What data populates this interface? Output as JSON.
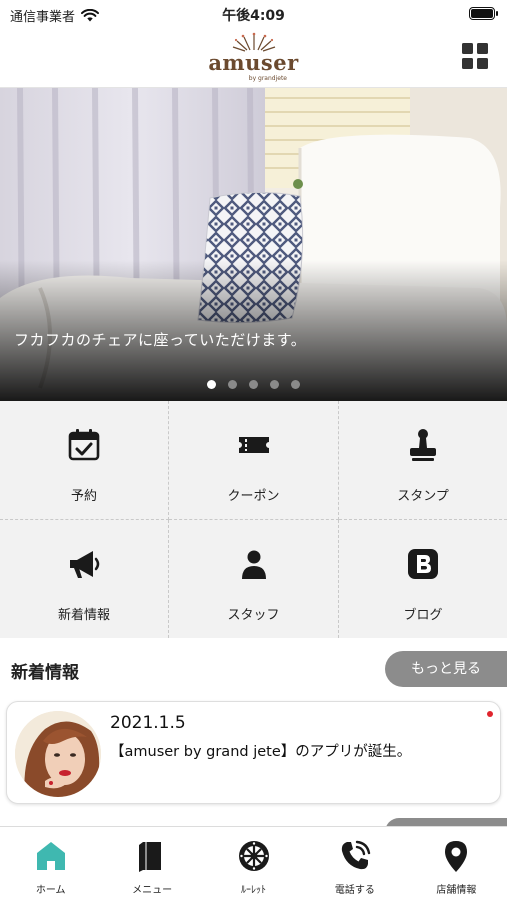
{
  "status_bar": {
    "carrier": "通信事業者",
    "time": "午後4:09"
  },
  "header": {
    "logo_text": "amuser",
    "logo_sub": "by grandjete"
  },
  "hero": {
    "caption": "フカフカのチェアに座っていただけます。",
    "slide_count": 5,
    "active_slide": 1
  },
  "features": [
    {
      "label": "予約",
      "icon": "calendar-icon"
    },
    {
      "label": "クーポン",
      "icon": "ticket-icon"
    },
    {
      "label": "スタンプ",
      "icon": "stamp-icon"
    },
    {
      "label": "新着情報",
      "icon": "megaphone-icon"
    },
    {
      "label": "スタッフ",
      "icon": "person-icon"
    },
    {
      "label": "ブログ",
      "icon": "blog-icon"
    }
  ],
  "news": {
    "title": "新着情報",
    "more_label": "もっと見る",
    "items": [
      {
        "date": "2021.1.5",
        "text": "【amuser by grand jete】のアプリが誕生。",
        "unread": true
      }
    ]
  },
  "tabs": [
    {
      "label": "ホーム",
      "icon": "home-icon",
      "active": true
    },
    {
      "label": "メニュー",
      "icon": "book-icon"
    },
    {
      "label": "ﾙｰﾚｯﾄ",
      "icon": "roulette-icon"
    },
    {
      "label": "電話する",
      "icon": "phone-icon"
    },
    {
      "label": "店舗情報",
      "icon": "map-pin-icon"
    }
  ],
  "colors": {
    "accent_active_tab": "#3fb8b0",
    "logo_brown": "#6b4a2f",
    "more_button": "#8c8c8c",
    "unread_dot": "#e0242d"
  }
}
